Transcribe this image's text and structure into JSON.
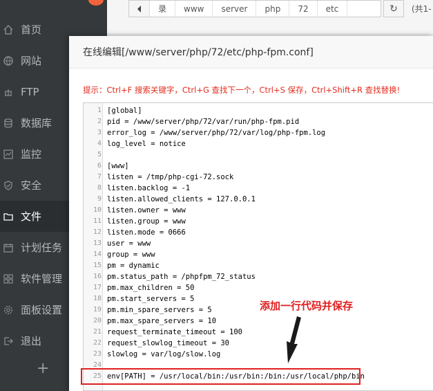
{
  "sidebar": {
    "items": [
      {
        "label": "首页",
        "icon": "home-icon"
      },
      {
        "label": "网站",
        "icon": "globe-icon"
      },
      {
        "label": "FTP",
        "icon": "ftp-icon"
      },
      {
        "label": "数据库",
        "icon": "database-icon"
      },
      {
        "label": "监控",
        "icon": "monitor-icon"
      },
      {
        "label": "安全",
        "icon": "shield-icon"
      },
      {
        "label": "文件",
        "icon": "folder-icon",
        "active": true
      },
      {
        "label": "计划任务",
        "icon": "calendar-icon"
      },
      {
        "label": "软件管理",
        "icon": "apps-icon"
      },
      {
        "label": "面板设置",
        "icon": "gear-icon"
      },
      {
        "label": "退出",
        "icon": "logout-icon"
      }
    ],
    "add_label": "+"
  },
  "pathbar": {
    "segments": [
      "录",
      "www",
      "server",
      "php",
      "72",
      "etc"
    ],
    "total_text": "(共1-"
  },
  "dialog": {
    "title": "在线编辑[/www/server/php/72/etc/php-fpm.conf]",
    "hint": "提示：Ctrl+F 搜索关键字，Ctrl+G 查找下一个，Ctrl+S 保存，Ctrl+Shift+R 查找替换!"
  },
  "editor": {
    "lines": [
      "[global]",
      "pid = /www/server/php/72/var/run/php-fpm.pid",
      "error_log = /www/server/php/72/var/log/php-fpm.log",
      "log_level = notice",
      "",
      "[www]",
      "listen = /tmp/php-cgi-72.sock",
      "listen.backlog = -1",
      "listen.allowed_clients = 127.0.0.1",
      "listen.owner = www",
      "listen.group = www",
      "listen.mode = 0666",
      "user = www",
      "group = www",
      "pm = dynamic",
      "pm.status_path = /phpfpm_72_status",
      "pm.max_children = 50",
      "pm.start_servers = 5",
      "pm.min_spare_servers = 5",
      "pm.max_spare_servers = 10",
      "request_terminate_timeout = 100",
      "request_slowlog_timeout = 30",
      "slowlog = var/log/slow.log",
      "",
      "env[PATH] = /usr/local/bin:/usr/bin:/bin:/usr/local/php/bin"
    ]
  },
  "annotation": {
    "label": "添加一行代码并保存"
  },
  "colors": {
    "sidebar_bg": "#35393b",
    "hint_red": "#e32b1d",
    "annotation_red": "#e02020"
  }
}
